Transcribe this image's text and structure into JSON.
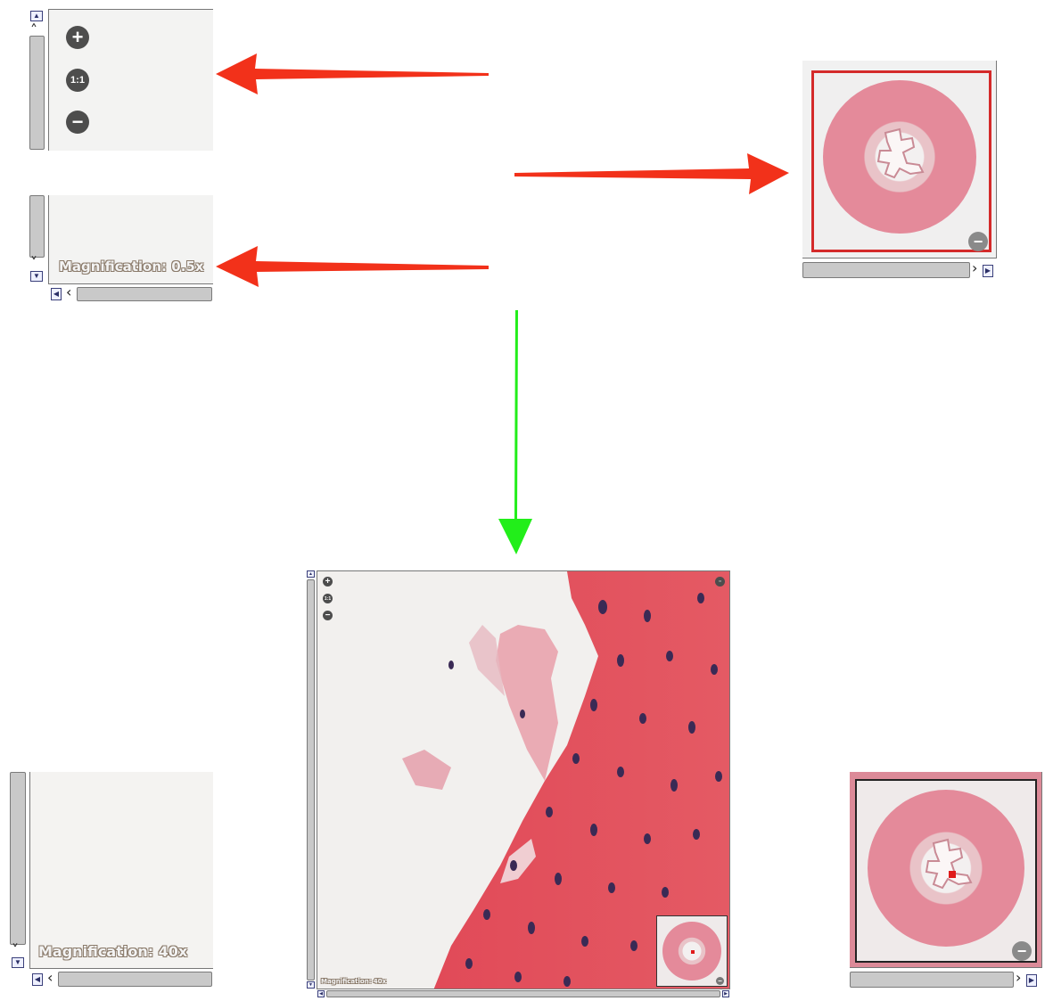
{
  "zoom_controls": {
    "zoom_in_label": "+",
    "reset_label": "1:1",
    "zoom_out_label": "−"
  },
  "magnification_top": "Magnification: 0.5x",
  "magnification_bottom": "Magnification: 40x",
  "magnification_main": "Magnification: 40x",
  "colors": {
    "red_arrow": "#f2311a",
    "green_arrow": "#22ee1a",
    "tissue_pink": "#e48a9a",
    "tissue_red": "#e14a58",
    "viewport_frame": "#d42a2a"
  }
}
